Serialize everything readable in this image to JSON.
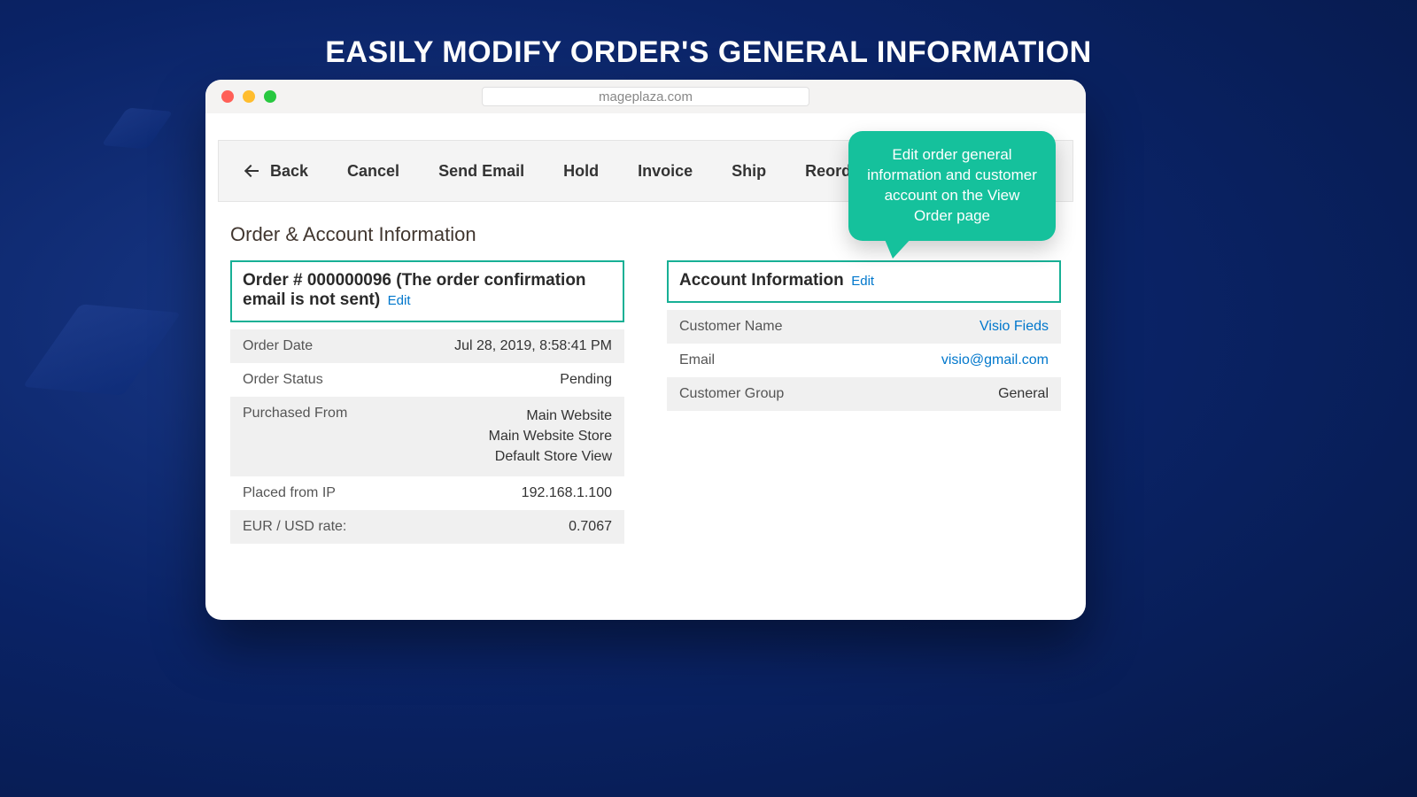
{
  "marketing_title": "EASILY MODIFY ORDER'S GENERAL INFORMATION",
  "browser": {
    "address": "mageplaza.com"
  },
  "callout": "Edit order general information and customer account on the View Order page",
  "toolbar": {
    "back": "Back",
    "cancel": "Cancel",
    "send_email": "Send Email",
    "hold": "Hold",
    "invoice": "Invoice",
    "ship": "Ship",
    "reorder": "Reorder"
  },
  "section_heading": "Order & Account Information",
  "order_box": {
    "title": "Order # 000000096 (The order confirmation email is not sent)",
    "edit": "Edit",
    "rows": [
      {
        "label": "Order Date",
        "value": "Jul 28, 2019, 8:58:41 PM"
      },
      {
        "label": "Order Status",
        "value": "Pending"
      },
      {
        "label": "Purchased From",
        "value": "Main Website\nMain Website Store\nDefault Store View"
      },
      {
        "label": "Placed from IP",
        "value": "192.168.1.100"
      },
      {
        "label": "EUR / USD rate:",
        "value": "0.7067"
      }
    ]
  },
  "account_box": {
    "title": "Account Information",
    "edit": "Edit",
    "rows": [
      {
        "label": "Customer Name",
        "value": "Visio Fieds",
        "link": true
      },
      {
        "label": "Email",
        "value": "visio@gmail.com",
        "link": true
      },
      {
        "label": "Customer Group",
        "value": "General"
      }
    ]
  }
}
